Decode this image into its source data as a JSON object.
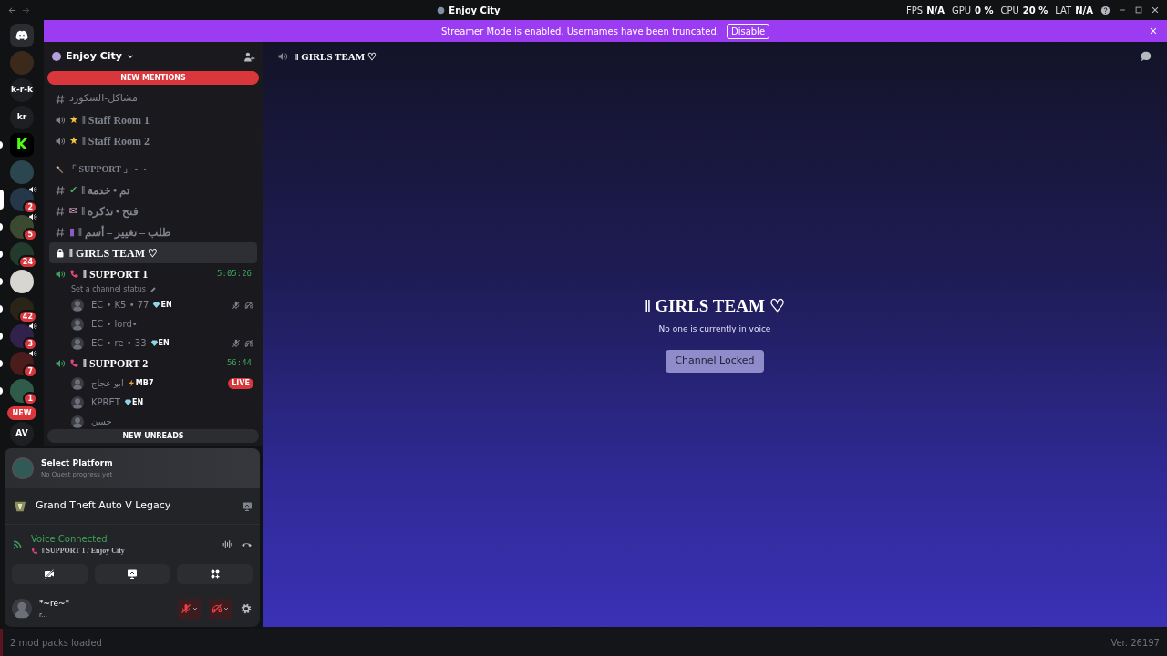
{
  "titlebar": {
    "title": "Enjoy City"
  },
  "overlay_stats": [
    {
      "label": "FPS",
      "value": "N/A"
    },
    {
      "label": "GPU",
      "value": "0 %"
    },
    {
      "label": "CPU",
      "value": "20 %"
    },
    {
      "label": "LAT",
      "value": "N/A"
    }
  ],
  "banner": {
    "text": "Streamer Mode is enabled. Usernames have been truncated.",
    "button": "Disable"
  },
  "servers": [
    {
      "kind": "logo",
      "selected": false,
      "unread": false
    },
    {
      "kind": "image",
      "selected": false,
      "unread": false
    },
    {
      "kind": "text",
      "label": "k-r-k",
      "selected": false,
      "unread": false
    },
    {
      "kind": "text",
      "label": "kr",
      "selected": false,
      "unread": false
    },
    {
      "kind": "brand",
      "label": "K",
      "selected": false,
      "unread": true
    },
    {
      "kind": "image",
      "selected": false,
      "unread": false
    },
    {
      "kind": "image",
      "selected": true,
      "unread": false,
      "badge": "2",
      "speaker": true
    },
    {
      "kind": "image",
      "selected": false,
      "unread": true,
      "badge": "5",
      "speaker": true
    },
    {
      "kind": "image",
      "selected": false,
      "unread": true,
      "badge": "24"
    },
    {
      "kind": "image",
      "selected": false,
      "unread": true
    },
    {
      "kind": "image",
      "selected": false,
      "unread": true,
      "badge": "42"
    },
    {
      "kind": "image",
      "selected": false,
      "unread": true,
      "badge": "3",
      "speaker": true
    },
    {
      "kind": "image",
      "selected": false,
      "unread": true,
      "badge": "7",
      "speaker": true
    },
    {
      "kind": "image",
      "selected": false,
      "unread": true,
      "badge": "1"
    },
    {
      "kind": "new",
      "label": "NEW",
      "selected": false,
      "unread": false
    },
    {
      "kind": "text",
      "label": "AV",
      "selected": false,
      "unread": false
    }
  ],
  "server_header": {
    "name": "Enjoy City"
  },
  "new_mentions": "NEW MENTIONS",
  "channels": [
    {
      "kind": "text",
      "name": "مشاكل-السكورد",
      "selected": false
    },
    {
      "kind": "voice",
      "emoji": "★",
      "name": "ǁ Staff Room 1",
      "selected": false
    },
    {
      "kind": "voice",
      "emoji": "★",
      "name": "ǁ Staff Room 2",
      "selected": false
    },
    {
      "kind": "category",
      "name": "「 SUPPORT 」 -",
      "selected": false
    },
    {
      "kind": "text",
      "emoji": "✔",
      "name": "ǁ تم • خدمة",
      "selected": false
    },
    {
      "kind": "text",
      "emoji": "✉",
      "name": "ǁ فتح • تذكرة",
      "selected": false
    },
    {
      "kind": "text",
      "emoji": "▮",
      "name": "ǁ طلب – تغيير – أسم",
      "selected": false
    },
    {
      "kind": "locked",
      "name": "ǁ GIRLS TEAM ♡",
      "selected": true
    },
    {
      "kind": "active",
      "name": "ǁ SUPPORT 1",
      "timer": "5:05:26",
      "status": "Set a channel status",
      "selected": false,
      "members": [
        {
          "name": "EC • K5 • 77",
          "tag": "EN",
          "muted": true,
          "deafened": true,
          "live": false
        },
        {
          "name": "EC • lord•",
          "muted": false,
          "deafened": false,
          "live": false
        },
        {
          "name": "EC • re • 33",
          "tag": "EN",
          "muted": true,
          "deafened": true,
          "live": false
        }
      ]
    },
    {
      "kind": "active",
      "name": "ǁ SUPPORT 2",
      "timer": "56:44",
      "selected": false,
      "members": [
        {
          "name": "ابو عجاج",
          "tag": "MB7",
          "muted": false,
          "deafened": false,
          "live": true,
          "live_label": "LIVE"
        },
        {
          "name": "KPRET",
          "tag": "EN",
          "muted": false,
          "deafened": false,
          "live": false
        },
        {
          "name": "حسن",
          "muted": false,
          "deafened": false,
          "live": false
        }
      ]
    }
  ],
  "new_unreads": "NEW UNREADS",
  "quest": {
    "title": "Select Platform",
    "subtitle": "No Quest progress yet"
  },
  "game": {
    "name": "Grand Theft Auto V Legacy"
  },
  "voice": {
    "status": "Voice Connected",
    "channel": "ǁ SUPPORT 1 / Enjoy City"
  },
  "user": {
    "name": "*~re~*",
    "status": "r...",
    "mic_muted": true,
    "deafened": true
  },
  "main": {
    "channel": "ǁ GIRLS TEAM ♡",
    "title": "ǁ GIRLS TEAM ♡",
    "subtitle": "No one is currently in voice",
    "button": "Channel Locked"
  },
  "status_bar": {
    "left": "2 mod packs loaded",
    "right": "Ver. 26197"
  }
}
